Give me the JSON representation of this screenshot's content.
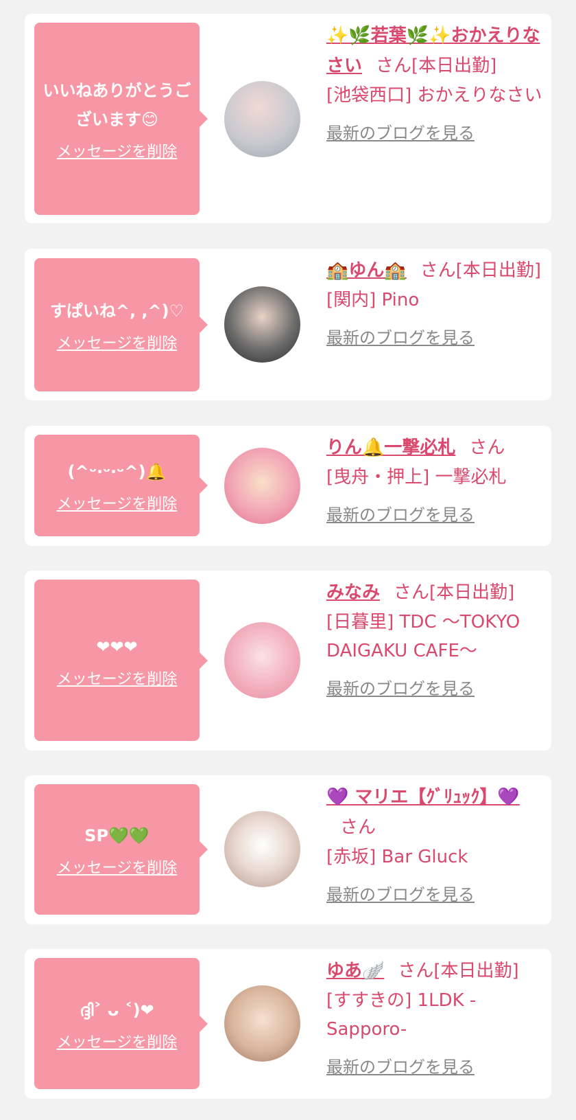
{
  "cards": [
    {
      "message": "いいねありがとうございます😊",
      "delete_label": "メッセージを削除",
      "name": "✨🌿若葉🌿✨おかえりなさい",
      "san": "さん[本日出勤]",
      "shop": "[池袋西口] おかえりなさい",
      "blog_label": "最新のブログを見る",
      "avatar_color": "#cfd8dc"
    },
    {
      "message": "すぱいね^, ,^)♡",
      "delete_label": "メッセージを削除",
      "name": "🏫ゆん🏫",
      "san": "さん[本日出勤]",
      "shop": "[関内] Pino",
      "blog_label": "最新のブログを見る",
      "avatar_color": "#444444"
    },
    {
      "message": "(^ᵕ‧ᵕ‧ᵕ^)🔔",
      "delete_label": "メッセージを削除",
      "name": "りん🔔一撃必札",
      "san": "さん",
      "shop": "[曳舟・押上] 一撃必札",
      "blog_label": "最新のブログを見る",
      "avatar_color": "#f4b6c2"
    },
    {
      "message": "❤❤❤",
      "delete_label": "メッセージを削除",
      "name": "みなみ",
      "san": "さん[本日出勤]",
      "shop": "[日暮里] TDC 〜TOKYO DAIGAKU CAFE〜",
      "blog_label": "最新のブログを見る",
      "avatar_color": "#f7c5cf"
    },
    {
      "message": "SP💚💚",
      "delete_label": "メッセージを削除",
      "name": "💜 マリエ【ｸﾞﾘｭｯｸ】💜",
      "san": "さん",
      "shop": "[赤坂] Bar Gluck",
      "blog_label": "最新のブログを見る",
      "avatar_color": "#e8d5cc"
    },
    {
      "message": "ദ്ദി˃ ᴗ ˂)❤",
      "delete_label": "メッセージを削除",
      "name": "ゆあ🪽",
      "san": "さん[本日出勤]",
      "shop": "[すすきの] 1LDK -Sapporo-",
      "blog_label": "最新のブログを見る",
      "avatar_color": "#e9c9b4"
    }
  ]
}
